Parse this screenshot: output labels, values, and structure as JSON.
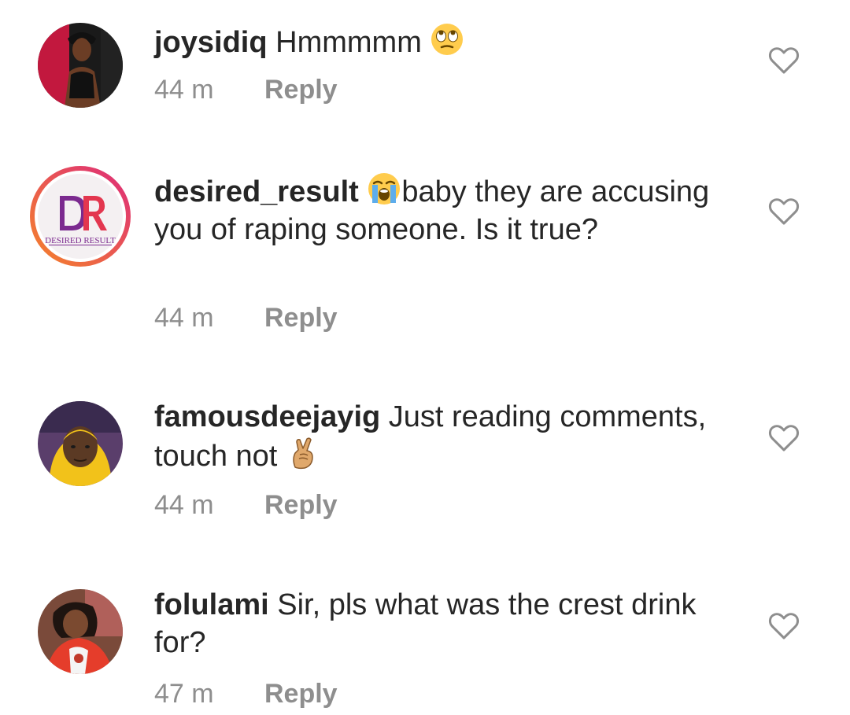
{
  "comments": [
    {
      "username": "joysidiq",
      "text_before": " Hmmmmm ",
      "emoji": "eye-roll-emoji",
      "text_after": "",
      "time": "44 m",
      "reply_label": "Reply"
    },
    {
      "username": "desired_result",
      "text_before": " ",
      "emoji": "loudly-crying-emoji",
      "text_after": "baby they are accusing you of raping someone. Is it true?",
      "time": "44 m",
      "reply_label": "Reply",
      "avatar_logo_text": "DESIRED RESULT"
    },
    {
      "username": "famousdeejayig",
      "text_before": " Just reading comments, touch not ",
      "emoji": "crossed-fingers-emoji",
      "text_after": "",
      "time": "44 m",
      "reply_label": "Reply"
    },
    {
      "username": "folulami",
      "text_before": " Sir, pls what was the crest drink for?",
      "emoji": "",
      "text_after": "",
      "time": "47 m",
      "reply_label": "Reply"
    }
  ],
  "colors": {
    "text": "#262626",
    "muted": "#8e8e8e",
    "icon": "#8e8e8e",
    "story_ring_start": "#f58529",
    "story_ring_end": "#dd2a7b"
  },
  "icons": {
    "like": "heart-outline-icon"
  }
}
